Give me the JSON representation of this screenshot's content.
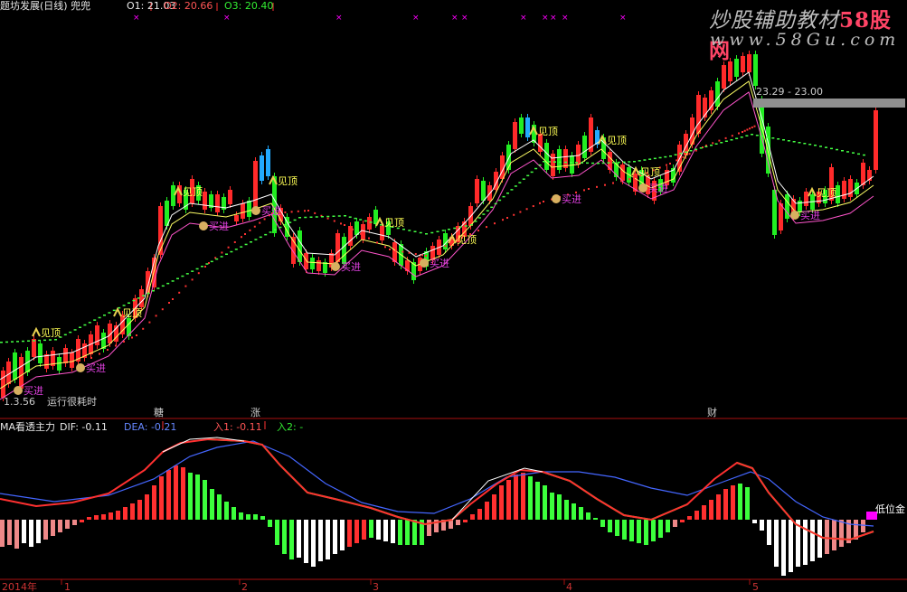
{
  "header": {
    "title": "题坊发展(日线) 兜兜",
    "o1": "O1: 21.03",
    "o2": "O2: 20.66",
    "o3": "O3: 20.40"
  },
  "watermark": {
    "line1_a": "炒股辅助教材",
    "line1_b": "58股网",
    "line2": "www.58Gu.com"
  },
  "price_panel": {
    "range_label": "23.29 - 23.00",
    "low_label": "1.3.56",
    "note": "运行很耗时",
    "event_labels": [
      "糖",
      "涨",
      "财"
    ],
    "signal_labels": {
      "buy": "买进",
      "top": "见顶"
    },
    "buy_count": 9,
    "top_count": 10
  },
  "indicator_panel": {
    "name": "MA看透主力",
    "dif": "DIF: -0.11",
    "dea": "DEA: -0.21",
    "in1": "入1: -0.11",
    "in2": "入2: -",
    "side_label": "低位金"
  },
  "time_axis": {
    "labels": [
      "2014年",
      "1",
      "2",
      "3",
      "4",
      "5"
    ]
  },
  "colors": {
    "up": "#ff2a2a",
    "down": "#22ee22",
    "cyan": "#22aaff",
    "dif_line": "#ff3030",
    "dea_line": "#4466ff",
    "signal": "#3cff3c",
    "pink": "#ee88aa",
    "magenta": "#ff00ff",
    "white": "#ffffff"
  }
}
